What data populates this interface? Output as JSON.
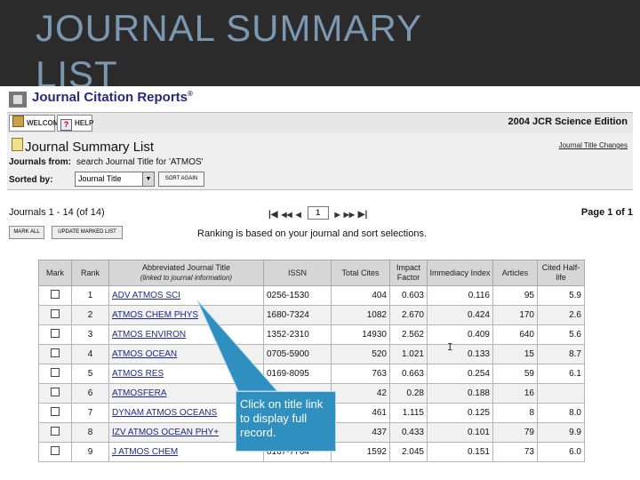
{
  "slide": {
    "title": "JOURNAL SUMMARY LIST"
  },
  "app": {
    "logo": "Journal Citation Reports",
    "registered": "®",
    "welcome_label": "WELCOME",
    "help_label": "HELP",
    "help_glyph": "?",
    "edition": "2004 JCR Science Edition"
  },
  "summary": {
    "title": "Journal Summary List",
    "title_changes_link": "Journal Title Changes",
    "journals_from_label": "Journals from:",
    "journals_from_value": "search Journal Title for 'ATMOS'",
    "sorted_by_label": "Sorted by:",
    "sorted_by_value": "Journal Title",
    "sort_again_label": "SORT AGAIN"
  },
  "paging": {
    "count": "Journals 1 - 14 (of 14)",
    "first": "|◀",
    "prev_fast": "◀◀",
    "prev": "◀",
    "page_value": "1",
    "next": "▶",
    "next_fast": "▶▶",
    "last": "▶|",
    "page_of": "Page 1 of 1"
  },
  "actions": {
    "mark_all": "MARK ALL",
    "update_marked": "UPDATE MARKED LIST",
    "ranking_note": "Ranking is based on your journal and sort selections."
  },
  "table": {
    "headers": {
      "mark": "Mark",
      "rank": "Rank",
      "title": "Abbreviated Journal Title",
      "title_sub": "(linked to journal information)",
      "issn": "ISSN",
      "total_cites": "Total Cites",
      "impact": "Impact Factor",
      "immediacy": "Immediacy Index",
      "articles": "Articles",
      "half_life": "Cited Half-life"
    },
    "rows": [
      {
        "rank": "1",
        "title": "ADV ATMOS SCI",
        "issn": "0256-1530",
        "cites": "404",
        "impact": "0.603",
        "immediacy": "0.116",
        "articles": "95",
        "half_life": "5.9"
      },
      {
        "rank": "2",
        "title": "ATMOS CHEM PHYS",
        "issn": "1680-7324",
        "cites": "1082",
        "impact": "2.670",
        "immediacy": "0.424",
        "articles": "170",
        "half_life": "2.6"
      },
      {
        "rank": "3",
        "title": "ATMOS ENVIRON",
        "issn": "1352-2310",
        "cites": "14930",
        "impact": "2.562",
        "immediacy": "0.409",
        "articles": "640",
        "half_life": "5.6"
      },
      {
        "rank": "4",
        "title": "ATMOS OCEAN",
        "issn": "0705-5900",
        "cites": "520",
        "impact": "1.021",
        "immediacy": "0.133",
        "articles": "15",
        "half_life": "8.7"
      },
      {
        "rank": "5",
        "title": "ATMOS RES",
        "issn": "0169-8095",
        "cites": "763",
        "impact": "0.663",
        "immediacy": "0.254",
        "articles": "59",
        "half_life": "6.1"
      },
      {
        "rank": "6",
        "title": "ATMOSFERA",
        "issn": "",
        "cites": "42",
        "impact": "0.28",
        "immediacy": "0.188",
        "articles": "16",
        "half_life": ""
      },
      {
        "rank": "7",
        "title": "DYNAM ATMOS OCEANS",
        "issn": "",
        "cites": "461",
        "impact": "1.115",
        "immediacy": "0.125",
        "articles": "8",
        "half_life": "8.0"
      },
      {
        "rank": "8",
        "title": "IZV ATMOS OCEAN PHY+",
        "issn": "",
        "cites": "437",
        "impact": "0.433",
        "immediacy": "0.101",
        "articles": "79",
        "half_life": "9.9"
      },
      {
        "rank": "9",
        "title": "J ATMOS CHEM",
        "issn": "0167-7764",
        "cites": "1592",
        "impact": "2.045",
        "immediacy": "0.151",
        "articles": "73",
        "half_life": "6.0"
      }
    ]
  },
  "callout": {
    "text": "Click on title link to display full record."
  },
  "colors": {
    "slide_header": "#2b2b2b",
    "title_text": "#7b98b0",
    "callout": "#2f8fbf",
    "link": "#1f2a8a"
  },
  "icons": [
    "welcome-home-icon",
    "help-question-icon",
    "summary-page-icon",
    "dropdown-arrow-icon",
    "text-cursor-icon"
  ]
}
